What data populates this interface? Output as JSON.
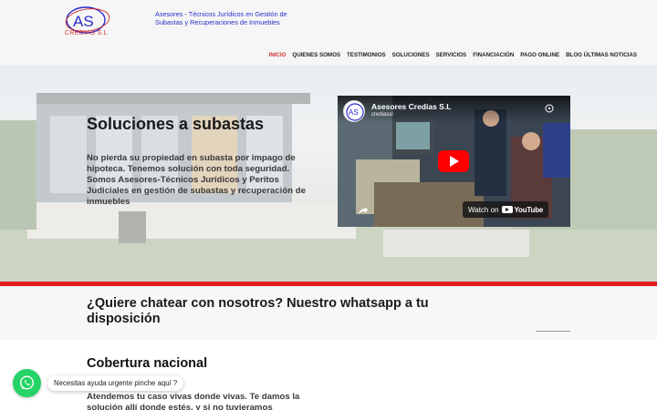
{
  "brand": {
    "logo_letters": "AS",
    "logo_sub": "CREDIAS S.L",
    "tagline": "Asesores - Técnicos Jurídicos en Gestión de Subastas y Recuperaciones de Inmuebles"
  },
  "nav": {
    "items": [
      {
        "label": "INICIO",
        "active": true
      },
      {
        "label": "QUIENES SOMOS"
      },
      {
        "label": "TESTIMONIOS"
      },
      {
        "label": "SOLUCIONES"
      },
      {
        "label": "SERVICIOS"
      },
      {
        "label": "FINANCIACIÓN"
      },
      {
        "label": "PAGO ONLINE"
      },
      {
        "label": "BLOG ÚLTIMAS NOTICIAS"
      }
    ]
  },
  "hero": {
    "title": "Soluciones a subastas",
    "text": "No pierda su propiedad en subasta por impago de hipoteca. Tenemos solución con toda seguridad. Somos Asesores-Técnicos Jurídicos y Peritos Judiciales en gestión de subastas y recuperación de inmuebles"
  },
  "video": {
    "title": "Asesores Credias S.L",
    "channel": "crediassl",
    "watch_label": "Watch on",
    "youtube_word": "YouTube",
    "play_icon": "play-icon",
    "share_icon": "share-icon"
  },
  "chat": {
    "title": "¿Quiere chatear con nosotros? Nuestro whatsapp a tu disposición"
  },
  "coverage": {
    "title": "Cobertura nacional",
    "text": "Atendemos tu caso vivas donde vivas. Te damos la solución allí donde estés, y si no tuvieramos"
  },
  "whatsapp": {
    "bubble": "Necesitas ayuda urgente pinche aquí ?",
    "icon": "whatsapp-icon"
  },
  "colors": {
    "accent_red": "#e41f1f",
    "brand_blue": "#2b2bc9",
    "whatsapp_green": "#25d366"
  }
}
